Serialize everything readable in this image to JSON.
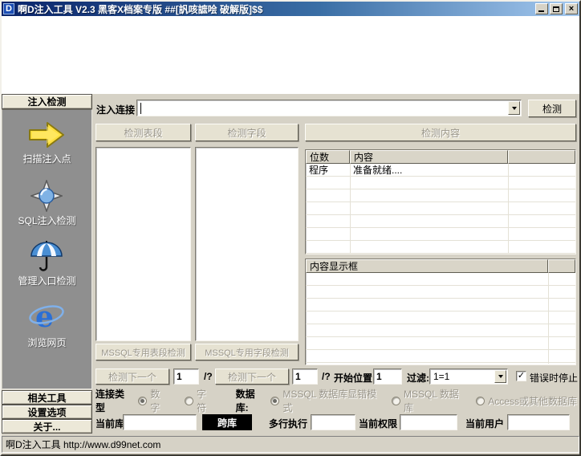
{
  "window": {
    "title": "啊D注入工具  V2.3 黑客X档案专版  ##[訉咳謶哙 破解版]$$",
    "app_icon_letter": "D",
    "controls": {
      "close_glyph": "×"
    }
  },
  "sidebar": {
    "header": "注入检测",
    "items": [
      {
        "label": "扫描注入点",
        "icon": "arrow-right-icon"
      },
      {
        "label": "SQL注入检测",
        "icon": "compass-icon"
      },
      {
        "label": "管理入口检测",
        "icon": "umbrella-icon"
      },
      {
        "label": "浏览网页",
        "icon": "ie-browser-icon"
      }
    ],
    "footer": [
      {
        "label": "相关工具"
      },
      {
        "label": "设置选项"
      },
      {
        "label": "关于..."
      }
    ]
  },
  "main": {
    "link_label": "注入连接",
    "link_value": "",
    "detect_button": "检测",
    "sections": {
      "tables": "检测表段",
      "fields": "检测字段",
      "content": "检测内容"
    },
    "result_table": {
      "col_digits": "位数",
      "col_content": "内容",
      "rows": [
        {
          "digits": "程序",
          "content": "准备就绪...."
        }
      ]
    },
    "content_box_title": "内容显示框",
    "mssql_tables_button": "MSSQL专用表段检测",
    "mssql_fields_button": "MSSQL专用字段检测",
    "controls": {
      "detect_next": "检测下一个",
      "table_index": "1",
      "table_total": "/?",
      "field_index": "1",
      "field_total": "/?",
      "start_label": "开始位置",
      "start_value": "1",
      "filter_label": "过滤:",
      "filter_value": "1=1",
      "stop_label": "错误时停止",
      "stop_checked": true,
      "stop_check_glyph": "✓"
    },
    "conn": {
      "type_label": "连接类型",
      "type_options": [
        {
          "label": "数字",
          "selected": true
        },
        {
          "label": "字符",
          "selected": false
        }
      ],
      "db_label": "数据库:",
      "db_options": [
        {
          "label": "MSSQL 数据库显错模式",
          "selected": true
        },
        {
          "label": "MSSQL 数据库",
          "selected": false
        },
        {
          "label": "Access或其他数据库",
          "selected": false
        }
      ]
    },
    "bottom": {
      "current_db_label": "当前库",
      "current_db_value": "",
      "cross_db_button": "跨库",
      "multi_exec_label": "多行执行",
      "multi_exec_value": "",
      "priv_label": "当前权限",
      "priv_value": "",
      "user_label": "当前用户",
      "user_value": ""
    }
  },
  "statusbar": {
    "text": "啊D注入工具 http://www.d99net.com"
  },
  "colors": {
    "titlebar_start": "#0a246a",
    "titlebar_end": "#a6caf0",
    "chrome": "#d6d2c6",
    "panel_dark": "#8f8f8f",
    "arrow_yellow": "#ffdf3e",
    "ie_blue": "#2a6fd6"
  }
}
